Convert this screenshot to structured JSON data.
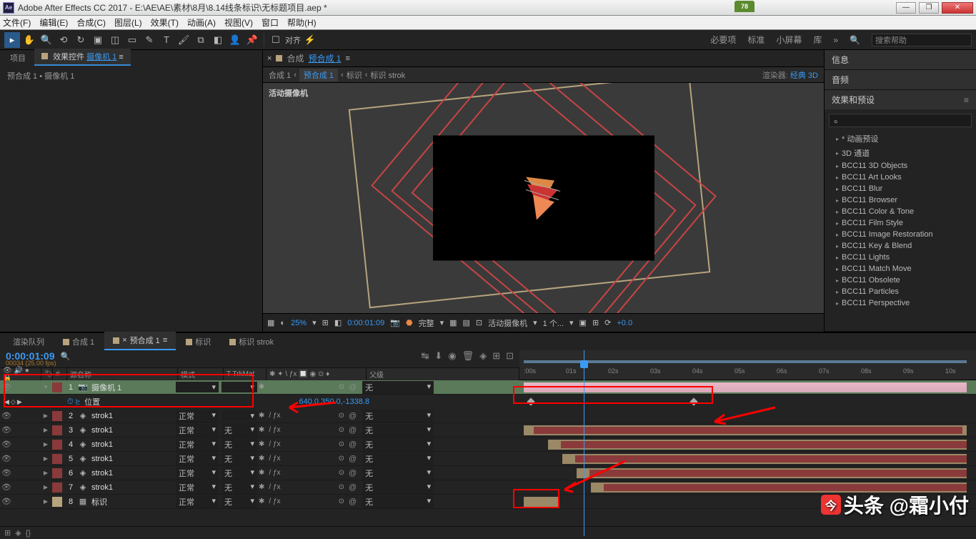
{
  "title": "Adobe After Effects CC 2017 - E:\\AE\\AE\\素材\\8月\\8.14线条标识\\无标题项目.aep *",
  "perf": "78",
  "menu": [
    "文件(F)",
    "编辑(E)",
    "合成(C)",
    "图层(L)",
    "效果(T)",
    "动画(A)",
    "视图(V)",
    "窗口",
    "帮助(H)"
  ],
  "toolbar_right": [
    "必要项",
    "标准",
    "小屏幕",
    "库",
    "»"
  ],
  "search_help": "搜索帮助",
  "align_label": "对齐",
  "project": {
    "tab1": "项目",
    "tab2": "效果控件 ",
    "tab2_link": "摄像机 1",
    "body": "预合成 1 • 摄像机 1"
  },
  "comp": {
    "label": "合成",
    "name": "预合成 1",
    "bc": [
      "合成 1",
      "预合成 1",
      "标识",
      "标识 strok"
    ],
    "renderer_l": "渲染器:",
    "renderer_v": "经典 3D",
    "active_cam": "活动摄像机"
  },
  "preview": {
    "zoom": "25%",
    "time": "0:00:01:09",
    "quality": "完整",
    "camera": "活动摄像机",
    "views": "1 个...",
    "exposure": "+0.0"
  },
  "right_panels": {
    "info": "信息",
    "audio": "音频",
    "effects": "效果和预设",
    "search": "ه"
  },
  "presets": [
    "* 动画预设",
    "3D 通道",
    "BCC11 3D Objects",
    "BCC11 Art Looks",
    "BCC11 Blur",
    "BCC11 Browser",
    "BCC11 Color & Tone",
    "BCC11 Film Style",
    "BCC11 Image Restoration",
    "BCC11 Key & Blend",
    "BCC11 Lights",
    "BCC11 Match Move",
    "BCC11 Obsolete",
    "BCC11 Particles",
    "BCC11 Perspective"
  ],
  "timeline": {
    "tabs": [
      "渲染队列",
      "合成 1",
      "预合成 1",
      "标识",
      "标识 strok"
    ],
    "active_tab": 2,
    "timecode": "0:00:01:09",
    "fps": "00034 (25.00 fps)",
    "cols": {
      "num": "#",
      "source": "源名称",
      "mode": "模式",
      "trkmat": "T  TrkMat",
      "parent": "父级"
    },
    "ruler": [
      ":00s",
      "01s",
      "02s",
      "03s",
      "04s",
      "05s",
      "06s",
      "07s",
      "08s",
      "09s",
      "10s"
    ],
    "layers": [
      {
        "n": 1,
        "color": "#8a3a3a",
        "icon": "📷",
        "name": "摄像机 1",
        "mode": "",
        "trkmat": "",
        "parent": "无",
        "selected": true
      },
      {
        "n": 2,
        "color": "#8a3a3a",
        "icon": "◈",
        "name": "strok1",
        "mode": "正常",
        "trkmat": "",
        "parent": "无"
      },
      {
        "n": 3,
        "color": "#8a3a3a",
        "icon": "◈",
        "name": "strok1",
        "mode": "正常",
        "trkmat": "无",
        "parent": "无"
      },
      {
        "n": 4,
        "color": "#8a3a3a",
        "icon": "◈",
        "name": "strok1",
        "mode": "正常",
        "trkmat": "无",
        "parent": "无"
      },
      {
        "n": 5,
        "color": "#8a3a3a",
        "icon": "◈",
        "name": "strok1",
        "mode": "正常",
        "trkmat": "无",
        "parent": "无"
      },
      {
        "n": 6,
        "color": "#8a3a3a",
        "icon": "◈",
        "name": "strok1",
        "mode": "正常",
        "trkmat": "无",
        "parent": "无"
      },
      {
        "n": 7,
        "color": "#8a3a3a",
        "icon": "◈",
        "name": "strok1",
        "mode": "正常",
        "trkmat": "无",
        "parent": "无"
      },
      {
        "n": 8,
        "color": "#b7a47d",
        "icon": "▦",
        "name": "标识",
        "mode": "正常",
        "trkmat": "无",
        "parent": "无"
      }
    ],
    "prop": {
      "name": "位置",
      "value": "640.0,350.0,-1338.8"
    }
  },
  "watermark": "头条 @霜小付"
}
